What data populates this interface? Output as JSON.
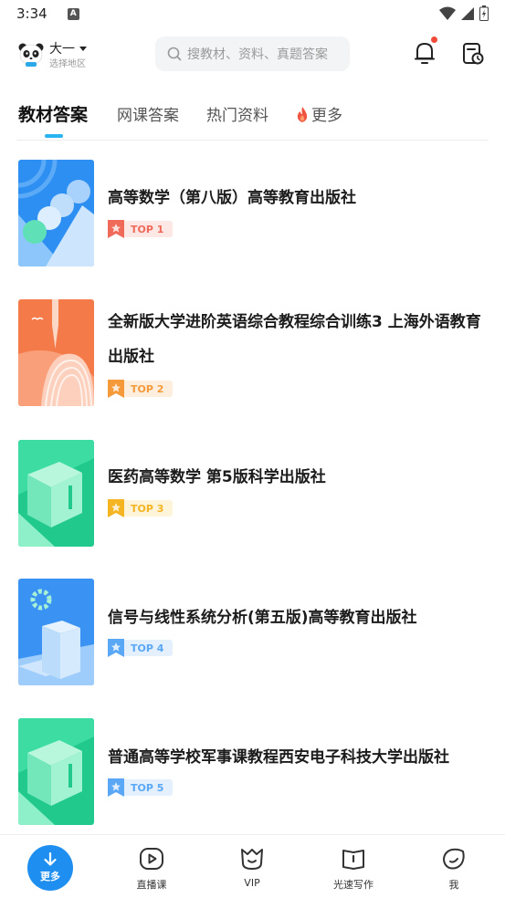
{
  "status_bar": {
    "time": "3:34",
    "indicator": "A"
  },
  "header": {
    "grade": "大一",
    "region": "选择地区",
    "search_placeholder": "搜教材、资料、真题答案",
    "has_notification": true
  },
  "tabs": [
    {
      "label": "教材答案",
      "active": true
    },
    {
      "label": "网课答案",
      "active": false
    },
    {
      "label": "热门资料",
      "active": false
    },
    {
      "label": "更多",
      "active": false
    }
  ],
  "books": [
    {
      "title": "高等数学（第八版）高等教育出版社",
      "rank": "TOP 1",
      "rank_color": "#f06a5a",
      "rank_bg": "#fde8e5"
    },
    {
      "title": "全新版大学进阶英语综合教程综合训练3 上海外语教育出版社",
      "rank": "TOP 2",
      "rank_color": "#f59a3a",
      "rank_bg": "#fdeedd"
    },
    {
      "title": "医药高等数学 第5版科学出版社",
      "rank": "TOP 3",
      "rank_color": "#f5b422",
      "rank_bg": "#fdf4da"
    },
    {
      "title": "信号与线性系统分析(第五版)高等教育出版社",
      "rank": "TOP 4",
      "rank_color": "#5aa8f5",
      "rank_bg": "#e4f0fd"
    },
    {
      "title": "普通高等学校军事课教程西安电子科技大学出版社",
      "rank": "TOP 5",
      "rank_color": "#5aa8f5",
      "rank_bg": "#e4f0fd"
    }
  ],
  "bottom_nav": [
    {
      "label": "更多",
      "icon": "download-icon"
    },
    {
      "label": "直播课",
      "icon": "play-icon"
    },
    {
      "label": "VIP",
      "icon": "vip-icon"
    },
    {
      "label": "光速写作",
      "icon": "writing-icon"
    },
    {
      "label": "我",
      "icon": "profile-icon"
    }
  ],
  "colors": {
    "accent": "#27b4f0",
    "primary_button": "#1e8ff0",
    "notification": "#f04a3a"
  }
}
